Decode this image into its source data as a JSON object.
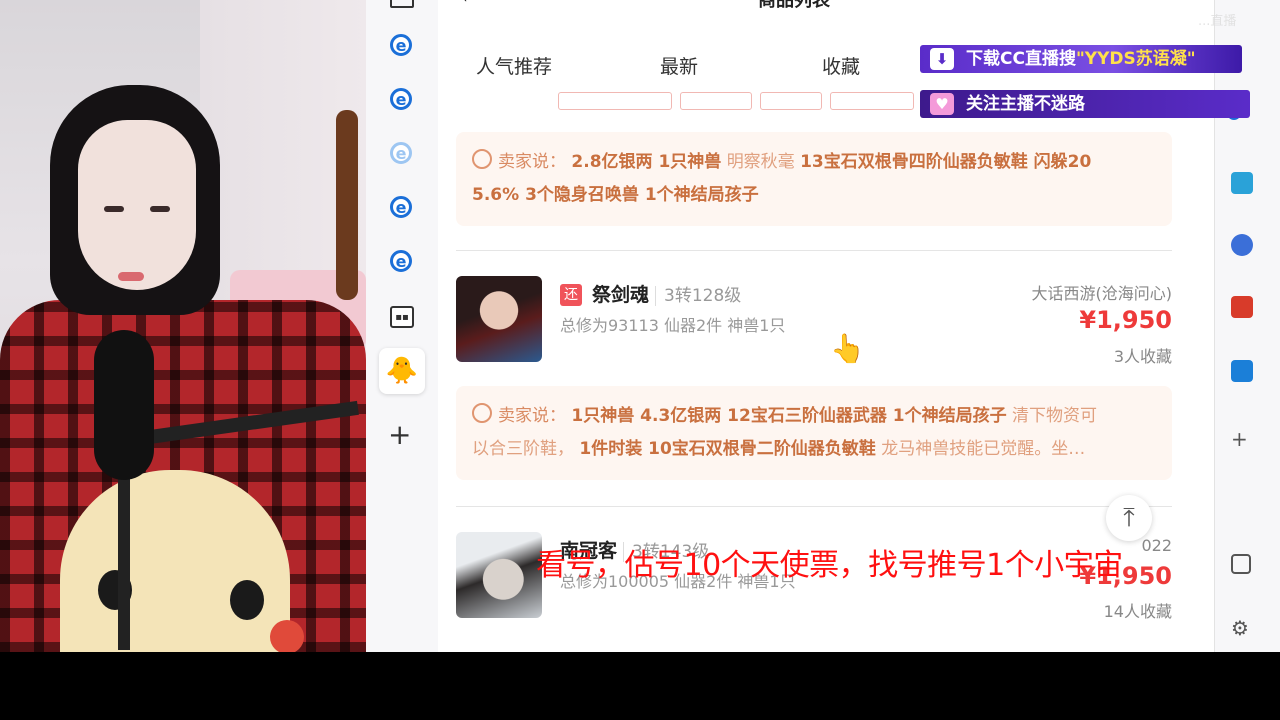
{
  "watermark": "...直播",
  "overlay": {
    "banner_download": {
      "prefix": "下载CC直播搜",
      "highlight": "\"YYDS苏语凝\""
    },
    "banner_follow": {
      "text": "关注主播不迷路"
    }
  },
  "subtitle": "看号，估号10个天使票，找号推号1个小宇宙",
  "app": {
    "title": "商品列表",
    "tabs": [
      "人气推荐",
      "最新",
      "收藏"
    ],
    "items": [
      {
        "seller_label": "卖家说：",
        "seller_bold": "2.8亿银两 1只神兽",
        "seller_normal1": "明察秋毫",
        "seller_bold2": "13宝石双根骨四阶仙器负敏鞋 闪躲20",
        "seller_bold3": "5.6% 3个隐身召唤兽 1个神结局孩子"
      },
      {
        "tag": "还",
        "name": "祭剑魂",
        "level": "3转128级",
        "sub": "总修为93113  仙器2件  神兽1只",
        "server": "大话西游(沧海问心)",
        "price": "¥1,950",
        "favorites": "3人收藏",
        "seller_label": "卖家说：",
        "seller_line1_bold": "1只神兽 4.3亿银两 12宝石三阶仙器武器 1个神结局孩子",
        "seller_line1_normal": "清下物资可",
        "seller_line2_normal1": "以合三阶鞋，",
        "seller_line2_bold": "1件时装 10宝石双根骨二阶仙器负敏鞋",
        "seller_line2_normal2": "龙马神兽技能已觉醒。坐…"
      },
      {
        "name": "南冠客",
        "level": "3转143级",
        "sub": "总修为100005  仙器2件  神兽1只",
        "server": "022",
        "price": "¥1,950",
        "favorites": "14人收藏"
      }
    ],
    "back_to_top": "⤒"
  }
}
